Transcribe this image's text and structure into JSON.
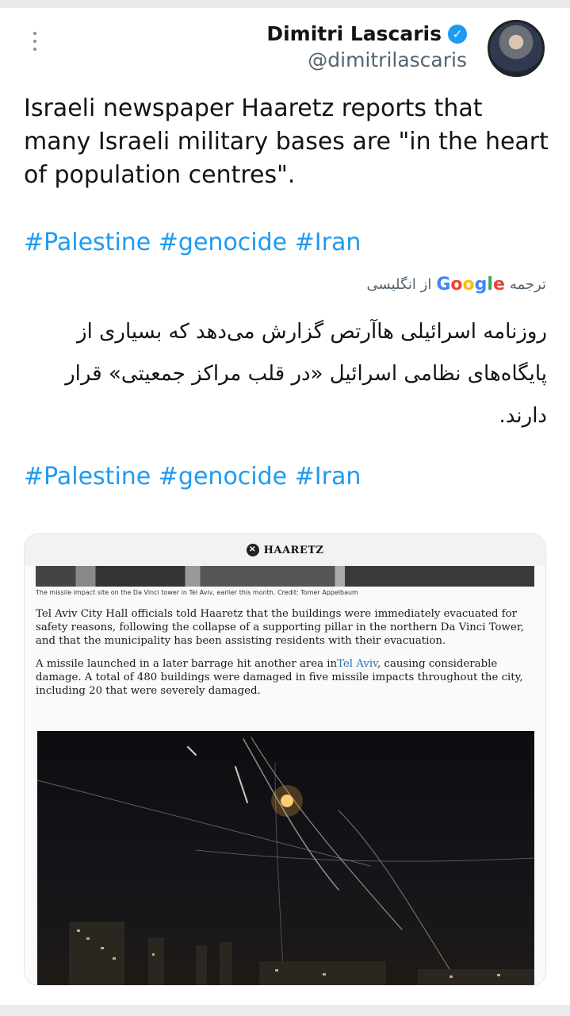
{
  "tweet": {
    "author_name": "Dimitri Lascaris",
    "author_handle": "@dimitrilascaris",
    "text": "Israeli newspaper Haaretz reports that many Israeli military bases are \"in the heart of population centres\".",
    "hashtags": "#Palestine #genocide #Iran"
  },
  "translation": {
    "label_before": "ترجمه",
    "provider": "Google",
    "label_after": "از انگلیسی",
    "text": "روزنامه اسرائیلی هاآرتص گزارش می‌دهد که بسیاری از پایگاه‌های نظامی اسرائیل «در قلب مراکز جمعیتی» قرار دارند.",
    "hashtags": "#Palestine #genocide #Iran"
  },
  "article_card": {
    "publication": "HAARETZ",
    "caption": "The missile impact site on the Da Vinci tower in Tel Aviv, earlier this month. Credit: Tomer Appelbaum",
    "paragraph1": "Tel Aviv City Hall officials told Haaretz that the buildings were immediately evacuated for safety reasons, following the collapse of a supporting pillar in the northern Da Vinci Tower, and that the municipality has been assisting residents with their evacuation.",
    "paragraph2_before": "A missile launched in a later barrage hit another area in",
    "paragraph2_link": "Tel Aviv",
    "paragraph2_after": ", causing considerable damage. A total of 480 buildings were damaged in five missile impacts throughout the city, including 20 that were severely damaged."
  },
  "icons": {
    "more": "more-vertical-icon",
    "verified": "verified-badge-icon",
    "publication_logo": "haaretz-logo-icon"
  },
  "colors": {
    "hashtag": "#1d9bf0",
    "verified": "#1d9bf0",
    "link": "#2c6fbf"
  }
}
